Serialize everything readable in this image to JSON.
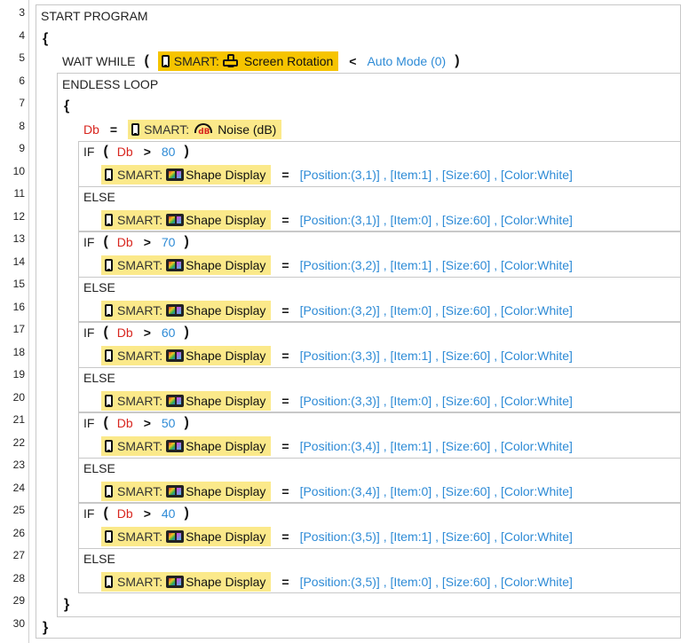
{
  "line_numbers": [
    "3",
    "4",
    "5",
    "6",
    "7",
    "8",
    "9",
    "10",
    "11",
    "12",
    "13",
    "14",
    "15",
    "16",
    "17",
    "18",
    "19",
    "20",
    "21",
    "22",
    "23",
    "24",
    "25",
    "26",
    "27",
    "28",
    "29",
    "30"
  ],
  "program": {
    "start": "START PROGRAM",
    "open_brace": "{",
    "close_brace": "}",
    "wait_while": "WAIT WHILE",
    "wait_lhs": {
      "smart_label": "SMART:",
      "function": "Screen Rotation"
    },
    "wait_op": "<",
    "wait_rhs": "Auto Mode (0)",
    "endless_loop": "ENDLESS LOOP",
    "loop_open_brace": "{",
    "loop_close_brace": "}",
    "assign": {
      "variable": "Db",
      "op": "=",
      "smart_label": "SMART:",
      "function": "Noise (dB)",
      "icon_text": "dB"
    },
    "if_kw": "IF",
    "else_kw": "ELSE",
    "paren_open": "(",
    "paren_close": ")",
    "gt": ">",
    "eq": "=",
    "smart_label": "SMART:",
    "shape_display": "Shape Display",
    "conditions": [
      {
        "var": "Db",
        "threshold": "80",
        "then": "[Position:(3,1)] , [Item:1] , [Size:60] , [Color:White]",
        "else": "[Position:(3,1)] , [Item:0] , [Size:60] , [Color:White]"
      },
      {
        "var": "Db",
        "threshold": "70",
        "then": "[Position:(3,2)] , [Item:1] , [Size:60] , [Color:White]",
        "else": "[Position:(3,2)] , [Item:0] , [Size:60] , [Color:White]"
      },
      {
        "var": "Db",
        "threshold": "60",
        "then": "[Position:(3,3)] , [Item:1] , [Size:60] , [Color:White]",
        "else": "[Position:(3,3)] , [Item:0] , [Size:60] , [Color:White]"
      },
      {
        "var": "Db",
        "threshold": "50",
        "then": "[Position:(3,4)] , [Item:1] , [Size:60] , [Color:White]",
        "else": "[Position:(3,4)] , [Item:0] , [Size:60] , [Color:White]"
      },
      {
        "var": "Db",
        "threshold": "40",
        "then": "[Position:(3,5)] , [Item:1] , [Size:60] , [Color:White]",
        "else": "[Position:(3,5)] , [Item:0] , [Size:60] , [Color:White]"
      }
    ]
  },
  "colors": {
    "variable": "#d8261f",
    "value": "#2e8bd6",
    "smart_block": "#fbe98a",
    "smart_block_active": "#f6c400"
  },
  "icons": [
    "phone-icon",
    "screen-rotation-icon",
    "noise-db-icon",
    "shape-display-icon"
  ]
}
